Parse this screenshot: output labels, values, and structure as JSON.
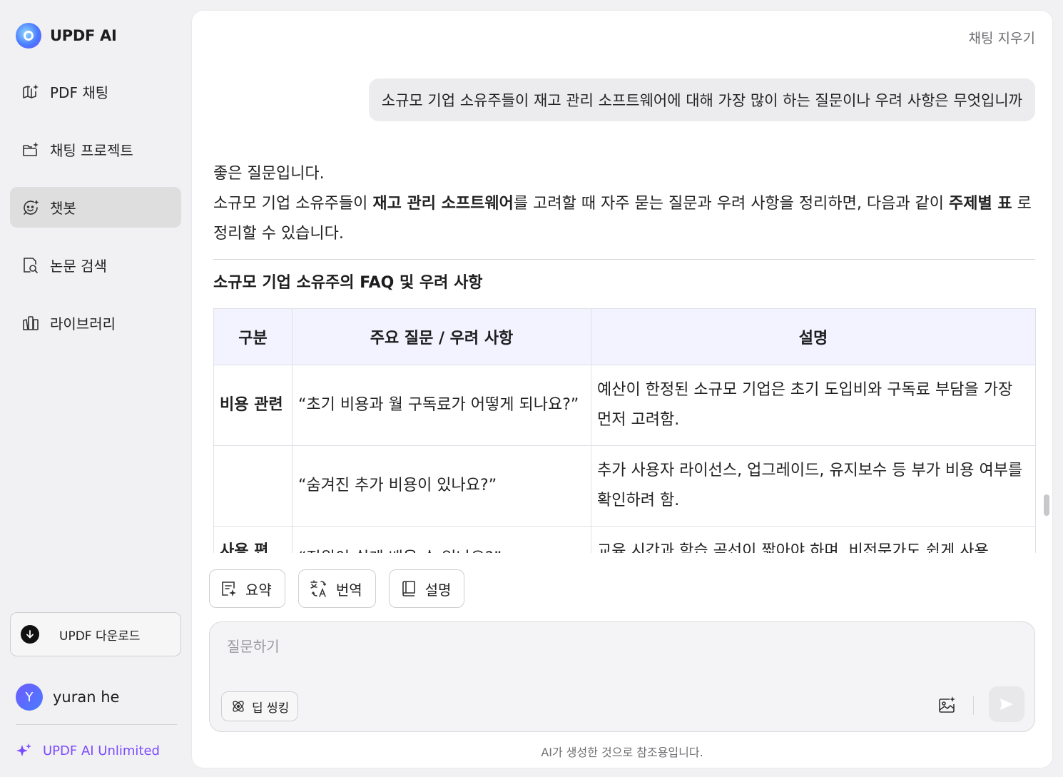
{
  "app": {
    "title": "UPDF AI"
  },
  "sidebar": {
    "items": [
      {
        "label": "PDF 채팅",
        "icon": "book-sparkle-icon"
      },
      {
        "label": "채팅 프로젝트",
        "icon": "folder-sparkle-icon"
      },
      {
        "label": "챗봇",
        "icon": "chatbot-face-icon",
        "active": true
      },
      {
        "label": "논문 검색",
        "icon": "document-search-icon"
      },
      {
        "label": "라이브러리",
        "icon": "library-books-icon"
      }
    ],
    "download_label": "UPDF 다운로드",
    "user": {
      "initial": "Y",
      "name": "yuran he"
    },
    "plan_label": "UPDF AI Unlimited"
  },
  "chat": {
    "clear_label": "채팅 지우기",
    "user_message": "소규모 기업 소유주들이 재고 관리 소프트웨어에 대해 가장 많이 하는 질문이나 우려 사항은 무엇입니까",
    "answer": {
      "intro": "좋은 질문입니다.",
      "line_part1": "소규모 기업 소유주들이 ",
      "line_bold1": "재고 관리 소프트웨어",
      "line_part2": "를 고려할 때 자주 묻는 질문과 우려 사항을 정리하면, 다음과 같이 ",
      "line_bold2": "주제별 표",
      "line_part3": " 로 정리할 수 있습니다.",
      "table_title": "소규모 기업 소유주의 FAQ 및 우려 사항",
      "table": {
        "headers": [
          "구분",
          "주요 질문 / 우려 사항",
          "설명"
        ],
        "rows": [
          {
            "category": "비용 관련",
            "question": "“초기 비용과 월 구독료가 어떻게 되나요?”",
            "description": "예산이 한정된 소규모 기업은 초기 도입비와 구독료 부담을 가장 먼저 고려함."
          },
          {
            "category": "",
            "question": "“숨겨진 추가 비용이 있나요?”",
            "description": "추가 사용자 라이선스, 업그레이드, 유지보수 등 부가 비용 여부를 확인하려 함."
          },
          {
            "category": "사용 편",
            "question": "“직원이 쉽게 배울 수 있나요?”",
            "description": "교육 시간과 학습 곡선이 짧아야 하며, 비전문가도 쉽게 사용"
          }
        ]
      }
    }
  },
  "quick_actions": [
    {
      "label": "요약",
      "icon": "summary-sparkle-icon"
    },
    {
      "label": "번역",
      "icon": "translate-icon"
    },
    {
      "label": "설명",
      "icon": "book-icon"
    }
  ],
  "input": {
    "placeholder": "질문하기",
    "value": "",
    "deep_think_label": "딥 씽킹"
  },
  "disclaimer": "AI가 생성한 것으로 참조용입니다."
}
